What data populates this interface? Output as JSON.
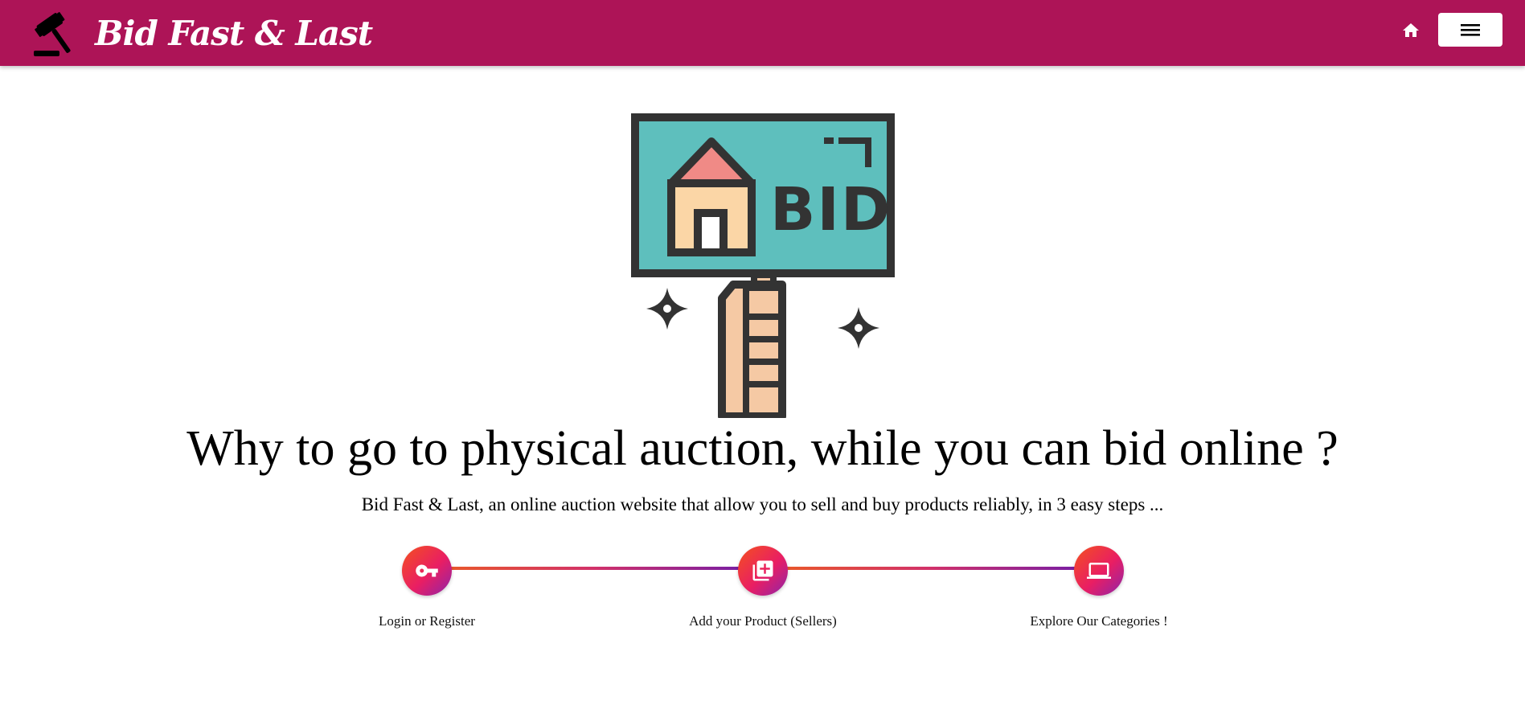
{
  "header": {
    "brand_name": "Bid Fast & Last",
    "brand_color": "#ad1457",
    "logo_icon": "gavel-icon",
    "home_icon": "home-icon",
    "menu_icon": "hamburger-menu-icon"
  },
  "hero": {
    "illustration": "bid-sign-illustration",
    "sign_text": "BID",
    "headline": "Why to go to physical auction, while you can bid online ?",
    "subheadline": "Bid Fast & Last, an online auction website that allow you to sell and buy products reliably, in 3 easy steps ..."
  },
  "steps": [
    {
      "icon": "key-icon",
      "label": "Login or Register"
    },
    {
      "icon": "add-box-icon",
      "label": "Add your Product (Sellers)"
    },
    {
      "icon": "laptop-icon",
      "label": "Explore Our Categories !"
    }
  ]
}
